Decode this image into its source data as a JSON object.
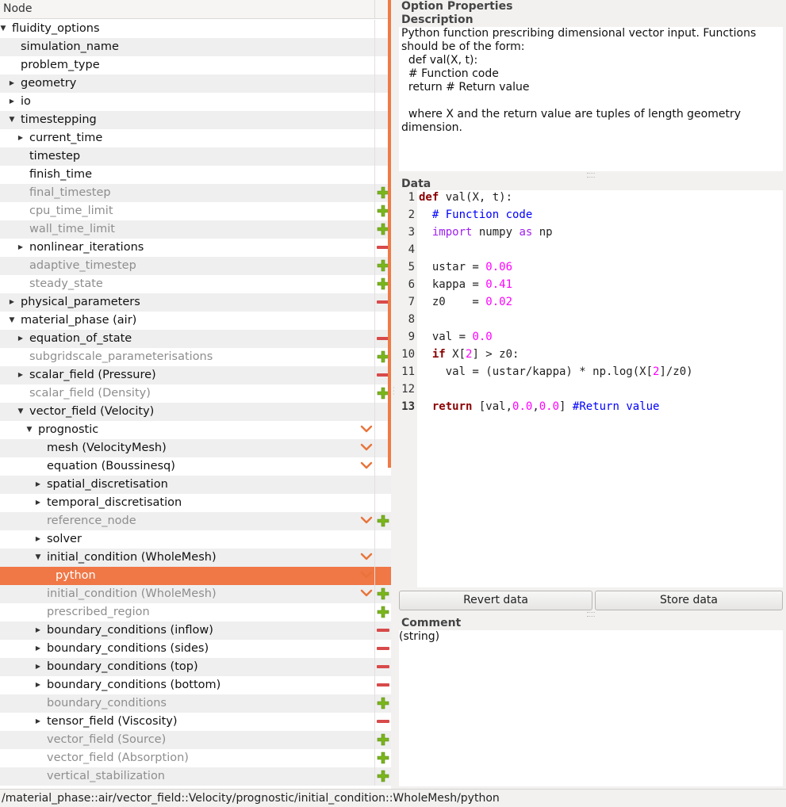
{
  "tree": {
    "header": "Node",
    "rows": [
      {
        "label": "fluidity_options",
        "depth": 0,
        "expander": "open",
        "active": true,
        "action": "none"
      },
      {
        "label": "simulation_name",
        "depth": 1,
        "expander": "none",
        "active": true,
        "action": "none"
      },
      {
        "label": "problem_type",
        "depth": 1,
        "expander": "none",
        "active": true,
        "action": "none"
      },
      {
        "label": "geometry",
        "depth": 1,
        "expander": "closed",
        "active": true,
        "action": "none"
      },
      {
        "label": "io",
        "depth": 1,
        "expander": "closed",
        "active": true,
        "action": "none"
      },
      {
        "label": "timestepping",
        "depth": 1,
        "expander": "open",
        "active": true,
        "action": "none"
      },
      {
        "label": "current_time",
        "depth": 2,
        "expander": "closed",
        "active": true,
        "action": "none"
      },
      {
        "label": "timestep",
        "depth": 2,
        "expander": "none",
        "active": true,
        "action": "none"
      },
      {
        "label": "finish_time",
        "depth": 2,
        "expander": "none",
        "active": true,
        "action": "none"
      },
      {
        "label": "final_timestep",
        "depth": 2,
        "expander": "none",
        "active": false,
        "action": "add"
      },
      {
        "label": "cpu_time_limit",
        "depth": 2,
        "expander": "none",
        "active": false,
        "action": "add"
      },
      {
        "label": "wall_time_limit",
        "depth": 2,
        "expander": "none",
        "active": false,
        "action": "add"
      },
      {
        "label": "nonlinear_iterations",
        "depth": 2,
        "expander": "closed",
        "active": true,
        "action": "remove"
      },
      {
        "label": "adaptive_timestep",
        "depth": 2,
        "expander": "none",
        "active": false,
        "action": "add"
      },
      {
        "label": "steady_state",
        "depth": 2,
        "expander": "none",
        "active": false,
        "action": "add"
      },
      {
        "label": "physical_parameters",
        "depth": 1,
        "expander": "closed",
        "active": true,
        "action": "remove"
      },
      {
        "label": "material_phase (air)",
        "depth": 1,
        "expander": "open",
        "active": true,
        "action": "none"
      },
      {
        "label": "equation_of_state",
        "depth": 2,
        "expander": "closed",
        "active": true,
        "action": "remove"
      },
      {
        "label": "subgridscale_parameterisations",
        "depth": 2,
        "expander": "none",
        "active": false,
        "action": "add"
      },
      {
        "label": "scalar_field (Pressure)",
        "depth": 2,
        "expander": "closed",
        "active": true,
        "action": "remove"
      },
      {
        "label": "scalar_field (Density)",
        "depth": 2,
        "expander": "none",
        "active": false,
        "action": "add"
      },
      {
        "label": "vector_field (Velocity)",
        "depth": 2,
        "expander": "open",
        "active": true,
        "action": "none"
      },
      {
        "label": "prognostic",
        "depth": 3,
        "expander": "open",
        "active": true,
        "action": "choice"
      },
      {
        "label": "mesh (VelocityMesh)",
        "depth": 4,
        "expander": "none",
        "active": true,
        "action": "choice"
      },
      {
        "label": "equation (Boussinesq)",
        "depth": 4,
        "expander": "none",
        "active": true,
        "action": "choice"
      },
      {
        "label": "spatial_discretisation",
        "depth": 4,
        "expander": "closed",
        "active": true,
        "action": "none"
      },
      {
        "label": "temporal_discretisation",
        "depth": 4,
        "expander": "closed",
        "active": true,
        "action": "none"
      },
      {
        "label": "reference_node",
        "depth": 4,
        "expander": "none",
        "active": false,
        "action": "choice-add"
      },
      {
        "label": "solver",
        "depth": 4,
        "expander": "closed",
        "active": true,
        "action": "none"
      },
      {
        "label": "initial_condition (WholeMesh)",
        "depth": 4,
        "expander": "open",
        "active": true,
        "action": "choice"
      },
      {
        "label": "python",
        "depth": 5,
        "expander": "none",
        "active": true,
        "action": "choice",
        "selected": true
      },
      {
        "label": "initial_condition (WholeMesh)",
        "depth": 4,
        "expander": "none",
        "active": false,
        "action": "choice-add"
      },
      {
        "label": "prescribed_region",
        "depth": 4,
        "expander": "none",
        "active": false,
        "action": "add"
      },
      {
        "label": "boundary_conditions (inflow)",
        "depth": 4,
        "expander": "closed",
        "active": true,
        "action": "remove"
      },
      {
        "label": "boundary_conditions (sides)",
        "depth": 4,
        "expander": "closed",
        "active": true,
        "action": "remove"
      },
      {
        "label": "boundary_conditions (top)",
        "depth": 4,
        "expander": "closed",
        "active": true,
        "action": "remove"
      },
      {
        "label": "boundary_conditions (bottom)",
        "depth": 4,
        "expander": "closed",
        "active": true,
        "action": "remove"
      },
      {
        "label": "boundary_conditions",
        "depth": 4,
        "expander": "none",
        "active": false,
        "action": "add"
      },
      {
        "label": "tensor_field (Viscosity)",
        "depth": 4,
        "expander": "closed",
        "active": true,
        "action": "remove"
      },
      {
        "label": "vector_field (Source)",
        "depth": 4,
        "expander": "none",
        "active": false,
        "action": "add"
      },
      {
        "label": "vector_field (Absorption)",
        "depth": 4,
        "expander": "none",
        "active": false,
        "action": "add"
      },
      {
        "label": "vertical_stabilization",
        "depth": 4,
        "expander": "none",
        "active": false,
        "action": "add"
      }
    ]
  },
  "properties": {
    "title": "Option Properties",
    "description_title": "Description",
    "description_text": "Python function prescribing dimensional vector input. Functions should be of the form:\n  def val(X, t):\n  # Function code\n  return # Return value\n\n  where X and the return value are tuples of length geometry dimension.",
    "data_title": "Data",
    "code_lines": [
      [
        {
          "t": "def",
          "c": "kw-def"
        },
        {
          "t": " val(X, t):"
        }
      ],
      [
        {
          "t": "  "
        },
        {
          "t": "# Function code",
          "c": "cmt"
        }
      ],
      [
        {
          "t": "  "
        },
        {
          "t": "import",
          "c": "kw-import"
        },
        {
          "t": " numpy "
        },
        {
          "t": "as",
          "c": "kw-import"
        },
        {
          "t": " np"
        }
      ],
      [
        {
          "t": ""
        }
      ],
      [
        {
          "t": "  ustar = "
        },
        {
          "t": "0.06",
          "c": "num"
        }
      ],
      [
        {
          "t": "  kappa = "
        },
        {
          "t": "0.41",
          "c": "num"
        }
      ],
      [
        {
          "t": "  z0    = "
        },
        {
          "t": "0.02",
          "c": "num"
        }
      ],
      [
        {
          "t": ""
        }
      ],
      [
        {
          "t": "  val = "
        },
        {
          "t": "0.0",
          "c": "num"
        }
      ],
      [
        {
          "t": "  "
        },
        {
          "t": "if",
          "c": "kw-ctrl"
        },
        {
          "t": " X["
        },
        {
          "t": "2",
          "c": "num"
        },
        {
          "t": "] > z0:"
        }
      ],
      [
        {
          "t": "    val = (ustar/kappa) * np.log(X["
        },
        {
          "t": "2",
          "c": "num"
        },
        {
          "t": "]/z0)"
        }
      ],
      [
        {
          "t": ""
        }
      ],
      [
        {
          "t": "  "
        },
        {
          "t": "return",
          "c": "kw-ctrl"
        },
        {
          "t": " [val,"
        },
        {
          "t": "0.0",
          "c": "num"
        },
        {
          "t": ","
        },
        {
          "t": "0.0",
          "c": "num"
        },
        {
          "t": "] "
        },
        {
          "t": "#Return value",
          "c": "cmt"
        }
      ]
    ],
    "current_line": 13,
    "revert_label": "Revert data",
    "store_label": "Store data",
    "comment_title": "Comment",
    "comment_text": "(string)"
  },
  "status": {
    "path": "/material_phase::air/vector_field::Velocity/prognostic/initial_condition::WholeMesh/python"
  },
  "colors": {
    "selection": "#f07746",
    "add": "#7ab51d",
    "remove": "#d84a4a",
    "choice": "#e8743a"
  }
}
